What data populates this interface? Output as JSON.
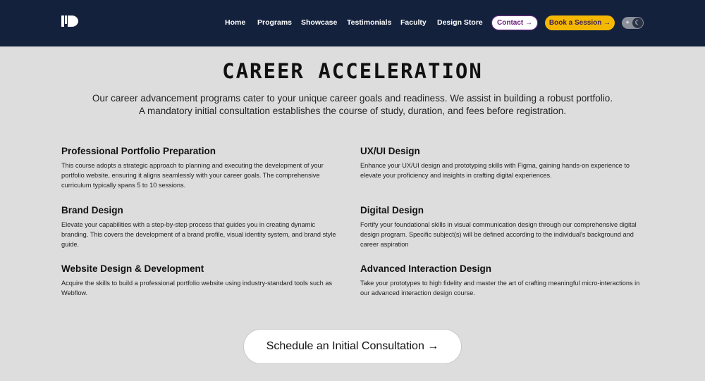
{
  "nav": {
    "links": [
      "Home",
      "Programs",
      "Showcase",
      "Testimonials",
      "Faculty",
      "Design Store"
    ],
    "contact_label": "Contact →",
    "book_label": "Book a Session →",
    "theme_toggle": {
      "sun_icon": "☀",
      "moon_icon": "☾"
    }
  },
  "hero": {
    "title": "CAREER ACCELERATION",
    "intro_line1": "Our career advancement programs cater to your unique career goals and readiness. We assist in building a robust portfolio.",
    "intro_line2": "A mandatory initial consultation establishes the course of study, duration, and fees before registration."
  },
  "courses": [
    {
      "title": "Professional Portfolio Preparation",
      "description": "This course adopts a strategic approach to planning and executing the development of your portfolio website, ensuring it aligns seamlessly with your career goals. The comprehensive curriculum typically spans 5 to 10 sessions."
    },
    {
      "title": "UX/UI Design",
      "description": "Enhance your UX/UI design and prototyping skills with Figma, gaining hands-on experience to elevate your proficiency and insights in crafting digital experiences."
    },
    {
      "title": "Brand Design",
      "description": "Elevate your capabilities with a step-by-step process that guides you in creating dynamic branding. This covers the development of a brand profile, visual identity system, and brand style guide."
    },
    {
      "title": "Digital Design",
      "description": "Fortify your foundational skills in visual communication design through our comprehensive digital design program. Specific subject(s) will be defined according to the individual's background and career aspiration"
    },
    {
      "title": "Website Design & Development",
      "description": "Acquire the skills to build a professional portfolio website using industry-standard tools such as Webflow."
    },
    {
      "title": "Advanced Interaction Design",
      "description": "Take your prototypes to high fidelity and master the art of crafting meaningful micro-interactions in our advanced interaction design course."
    }
  ],
  "cta": {
    "label": "Schedule an Initial Consultation →"
  },
  "colors": {
    "nav_background": "#14213d",
    "page_background": "#dddddd",
    "accent_yellow": "#f5b800",
    "accent_purple": "#6a1b7a"
  }
}
